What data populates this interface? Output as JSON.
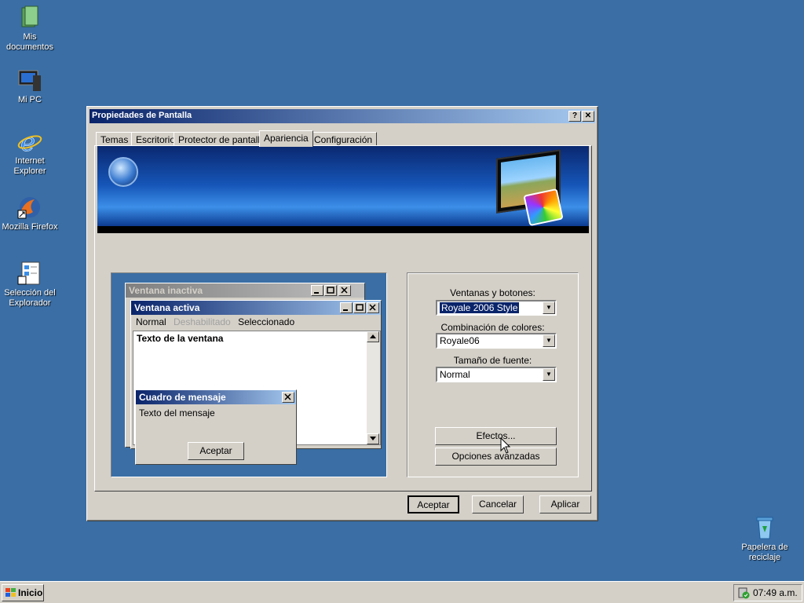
{
  "desktop": {
    "icons": [
      {
        "label": "Mis documentos",
        "icon": "folder-documents-icon"
      },
      {
        "label": "Mi PC",
        "icon": "computer-icon"
      },
      {
        "label": "Internet Explorer",
        "icon": "ie-icon"
      },
      {
        "label": "Mozilla Firefox",
        "icon": "firefox-icon"
      },
      {
        "label": "Selección del Explorador",
        "icon": "explorer-selector-icon"
      },
      {
        "label": "Papelera de reciclaje",
        "icon": "recycle-bin-icon"
      }
    ]
  },
  "dialog": {
    "title": "Propiedades de Pantalla",
    "help": "?",
    "close": "✕",
    "tabs": [
      "Temas",
      "Escritorio",
      "Protector de pantalla",
      "Apariencia",
      "Configuración"
    ],
    "active_tab": "Apariencia",
    "preview": {
      "inactive_title": "Ventana inactiva",
      "active_title": "Ventana activa",
      "menu_normal": "Normal",
      "menu_disabled": "Deshabilitado",
      "menu_selected": "Seleccionado",
      "window_text": "Texto de la ventana",
      "msg_title": "Cuadro de mensaje",
      "msg_text": "Texto del mensaje",
      "msg_ok": "Aceptar"
    },
    "settings": {
      "windows_label": "Ventanas y botones:",
      "windows_value": "Royale 2006 Style",
      "scheme_label": "Combinación de colores:",
      "scheme_value": "Royale06",
      "font_label": "Tamaño de fuente:",
      "font_value": "Normal",
      "effects": "Efectos...",
      "advanced": "Opciones avanzadas"
    },
    "buttons": {
      "ok": "Aceptar",
      "cancel": "Cancelar",
      "apply": "Aplicar"
    }
  },
  "taskbar": {
    "start": "Inicio",
    "clock": "07:49 a.m."
  }
}
